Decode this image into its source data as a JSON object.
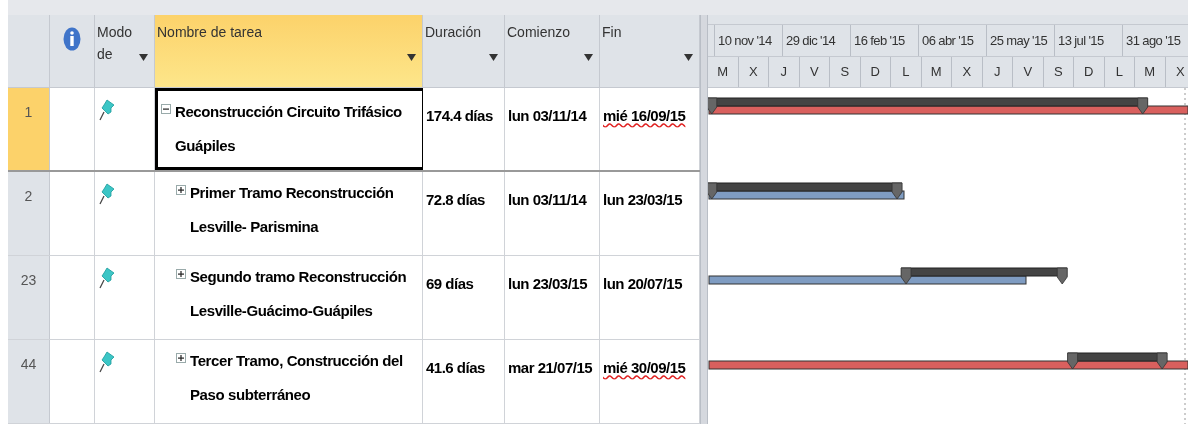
{
  "columns": [
    {
      "label": "Modo de",
      "selected": false
    },
    {
      "label": "Nombre de tarea",
      "selected": true
    },
    {
      "label": "Duración",
      "selected": false
    },
    {
      "label": "Comienzo",
      "selected": false
    },
    {
      "label": "Fin",
      "selected": false
    }
  ],
  "timescale": {
    "major": [
      "10 nov '14",
      "29 dic '14",
      "16 feb '15",
      "06 abr '15",
      "25 may '15",
      "13 jul '15",
      "31 ago '15"
    ],
    "minor": [
      "M",
      "X",
      "J",
      "V",
      "S",
      "D",
      "L",
      "M",
      "X",
      "J",
      "V",
      "S",
      "D",
      "L",
      "M",
      "X"
    ]
  },
  "tasks": [
    {
      "id": "1",
      "name": "Reconstrucción Circuito Trifásico Guápiles",
      "duration": "174.4 días",
      "start": "lun 03/11/14",
      "finish": "mié 16/09/15",
      "finish_flagged": true,
      "selected": true,
      "expanded": true,
      "color": "#d9605e",
      "children": [
        {
          "id": "2",
          "name": "Primer Tramo Reconstrucción Lesville- Parismina",
          "duration": "72.8 días",
          "start": "lun 03/11/14",
          "finish": "lun 23/03/15",
          "finish_flagged": false,
          "selected": false,
          "expanded": false,
          "color": "#7f9cc2"
        },
        {
          "id": "23",
          "name": "Segundo tramo Reconstrucción Lesville-Guácimo-Guápiles",
          "duration": "69 días",
          "start": "lun 23/03/15",
          "finish": "lun 20/07/15",
          "finish_flagged": false,
          "selected": false,
          "expanded": false,
          "color": "#7f9cc2"
        },
        {
          "id": "44",
          "name": "Tercer Tramo, Construcción del Paso subterráneo",
          "duration": "41.6 días",
          "start": "mar 21/07/15",
          "finish": "mié 30/09/15",
          "finish_flagged": true,
          "selected": false,
          "expanded": false,
          "color": "#d9605e"
        }
      ]
    }
  ]
}
